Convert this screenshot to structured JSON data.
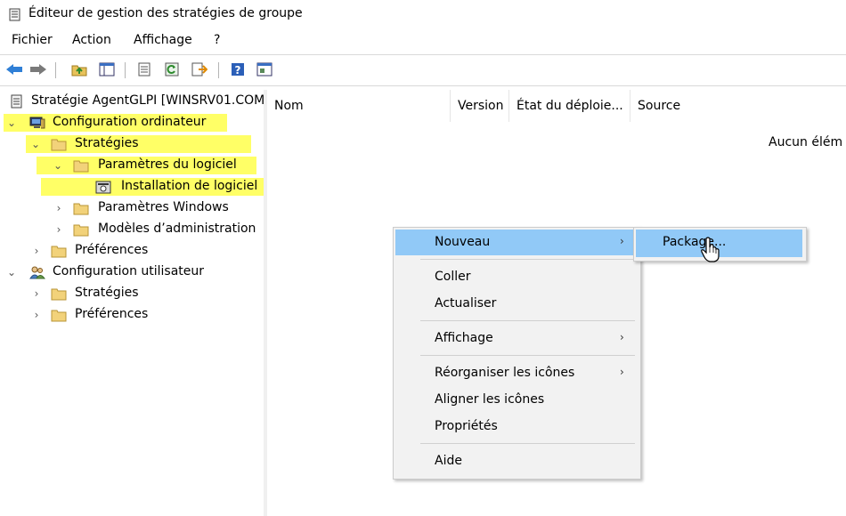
{
  "window": {
    "title": "Éditeur de gestion des stratégies de groupe",
    "icon": "policy-editor-icon"
  },
  "menubar": {
    "items": [
      "Fichier",
      "Action",
      "Affichage",
      "?"
    ]
  },
  "toolbar": {
    "buttons": [
      "back-arrow-icon",
      "forward-arrow-icon",
      "up-folder-icon",
      "show-hide-tree-icon",
      "properties-icon",
      "refresh-icon",
      "export-list-icon",
      "help-icon",
      "console-icon"
    ]
  },
  "tree": {
    "highlight_color": "#ffff66",
    "items": [
      {
        "label": "Stratégie AgentGLPI [WINSRV01.COM",
        "icon": "policy-doc-icon"
      },
      {
        "label": "Configuration ordinateur",
        "icon": "computer-icon",
        "expanded": true
      },
      {
        "label": "Stratégies",
        "icon": "folder-icon",
        "expanded": true
      },
      {
        "label": "Paramètres du logiciel",
        "icon": "folder-icon",
        "expanded": true
      },
      {
        "label": "Installation de logiciel",
        "icon": "software-install-icon",
        "selected": true
      },
      {
        "label": "Paramètres Windows",
        "icon": "folder-icon",
        "expanded": false
      },
      {
        "label": "Modèles d’administration",
        "icon": "folder-icon",
        "expanded": false
      },
      {
        "label": "Préférences",
        "icon": "folder-icon",
        "expanded": false
      },
      {
        "label": "Configuration utilisateur",
        "icon": "users-icon",
        "expanded": true
      },
      {
        "label": "Stratégies",
        "icon": "folder-icon",
        "expanded": false
      },
      {
        "label": "Préférences",
        "icon": "folder-icon",
        "expanded": false
      }
    ]
  },
  "list": {
    "columns": [
      "Nom",
      "Version",
      "État du déploie...",
      "Source"
    ],
    "empty_message": "Aucun élém"
  },
  "context_menu": {
    "highlight_color": "#91c9f7",
    "items": {
      "nouveau": "Nouveau",
      "coller": "Coller",
      "actualiser": "Actualiser",
      "affichage": "Affichage",
      "reorganiser": "Réorganiser les icônes",
      "aligner": "Aligner les icônes",
      "proprietes": "Propriétés",
      "aide": "Aide"
    },
    "submenu_arrow": "›"
  },
  "submenu": {
    "package": "Package..."
  }
}
